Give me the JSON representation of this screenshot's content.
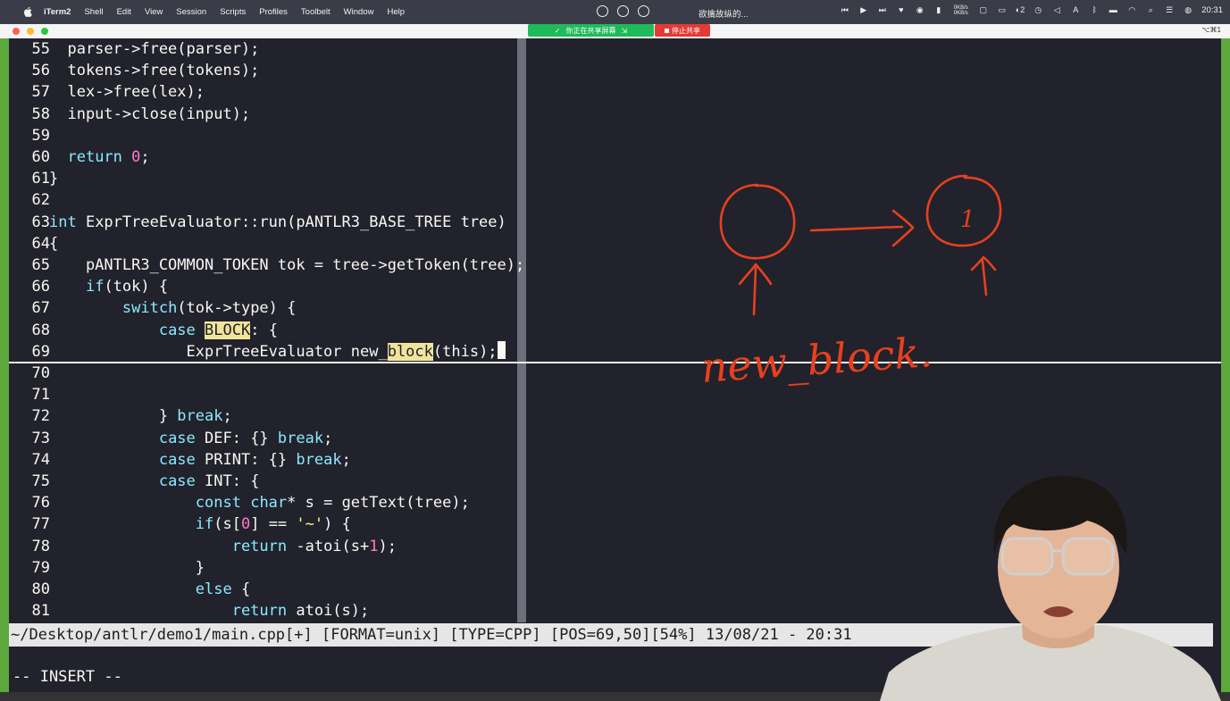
{
  "menubar": {
    "items": [
      "iTerm2",
      "Shell",
      "Edit",
      "View",
      "Session",
      "Scripts",
      "Profiles",
      "Toolbelt",
      "Window",
      "Help"
    ],
    "media_title": "欲擒故纵的...",
    "network_up": "0KB/s",
    "network_down": "0KB/s",
    "badge_count": "2",
    "clock": "20:31",
    "status_icons": [
      "prev-icon",
      "play-icon",
      "next-icon",
      "heart-icon",
      "music-icon",
      "battery-icon",
      "window-icon",
      "display-icon",
      "clock-status-icon",
      "volume-icon",
      "input-source-icon",
      "bluetooth-icon",
      "wifi-icon",
      "search-icon",
      "control-center-icon"
    ]
  },
  "screen_share": {
    "banner_label": "你正在共享屏幕",
    "stop_label": "停止共享"
  },
  "window": {
    "shortcut": "⌥⌘1",
    "colors": {
      "frame": "#5ea83d",
      "background": "#21222c",
      "keyword": "#8be9fd",
      "number": "#ff79c6",
      "search_highlight": "#f1e49a"
    }
  },
  "editor": {
    "lines": [
      {
        "num": "55",
        "parts": [
          {
            "t": "  parser->free(parser);"
          }
        ]
      },
      {
        "num": "56",
        "parts": [
          {
            "t": "  tokens->free(tokens);"
          }
        ]
      },
      {
        "num": "57",
        "parts": [
          {
            "t": "  lex->free(lex);"
          }
        ]
      },
      {
        "num": "58",
        "parts": [
          {
            "t": "  input->close(input);"
          }
        ]
      },
      {
        "num": "59",
        "parts": []
      },
      {
        "num": "60",
        "parts": [
          {
            "t": "  "
          },
          {
            "t": "return",
            "c": "kw"
          },
          {
            "t": " "
          },
          {
            "t": "0",
            "c": "num"
          },
          {
            "t": ";"
          }
        ]
      },
      {
        "num": "61",
        "parts": [
          {
            "t": "}"
          }
        ]
      },
      {
        "num": "62",
        "parts": []
      },
      {
        "num": "63",
        "parts": [
          {
            "t": "int",
            "c": "kw"
          },
          {
            "t": " ExprTreeEvaluator::run(pANTLR3_BASE_TREE tree)"
          }
        ]
      },
      {
        "num": "64",
        "parts": [
          {
            "t": "{"
          }
        ]
      },
      {
        "num": "65",
        "parts": [
          {
            "t": "    pANTLR3_COMMON_TOKEN tok = tree->getToken(tree);"
          }
        ]
      },
      {
        "num": "66",
        "parts": [
          {
            "t": "    "
          },
          {
            "t": "if",
            "c": "kw"
          },
          {
            "t": "(tok) {"
          }
        ]
      },
      {
        "num": "67",
        "parts": [
          {
            "t": "        "
          },
          {
            "t": "switch",
            "c": "kw"
          },
          {
            "t": "(tok->type) {"
          }
        ]
      },
      {
        "num": "68",
        "parts": [
          {
            "t": "            "
          },
          {
            "t": "case",
            "c": "kw"
          },
          {
            "t": " "
          },
          {
            "t": "BLOCK",
            "c": "hl"
          },
          {
            "t": ": {"
          }
        ]
      },
      {
        "num": "69",
        "parts": [
          {
            "t": "               ExprTreeEvaluator new_"
          },
          {
            "t": "block",
            "c": "hl"
          },
          {
            "t": "(this);"
          }
        ]
      },
      {
        "num": "70",
        "parts": []
      },
      {
        "num": "71",
        "parts": []
      },
      {
        "num": "72",
        "parts": [
          {
            "t": "            } "
          },
          {
            "t": "break",
            "c": "kw"
          },
          {
            "t": ";"
          }
        ]
      },
      {
        "num": "73",
        "parts": [
          {
            "t": "            "
          },
          {
            "t": "case",
            "c": "kw"
          },
          {
            "t": " DEF: {} "
          },
          {
            "t": "break",
            "c": "kw"
          },
          {
            "t": ";"
          }
        ]
      },
      {
        "num": "74",
        "parts": [
          {
            "t": "            "
          },
          {
            "t": "case",
            "c": "kw"
          },
          {
            "t": " PRINT: {} "
          },
          {
            "t": "break",
            "c": "kw"
          },
          {
            "t": ";"
          }
        ]
      },
      {
        "num": "75",
        "parts": [
          {
            "t": "            "
          },
          {
            "t": "case",
            "c": "kw"
          },
          {
            "t": " INT: {"
          }
        ]
      },
      {
        "num": "76",
        "parts": [
          {
            "t": "                "
          },
          {
            "t": "const",
            "c": "kw"
          },
          {
            "t": " "
          },
          {
            "t": "char",
            "c": "kw"
          },
          {
            "t": "* s = getText(tree);"
          }
        ]
      },
      {
        "num": "77",
        "parts": [
          {
            "t": "                "
          },
          {
            "t": "if",
            "c": "kw"
          },
          {
            "t": "(s["
          },
          {
            "t": "0",
            "c": "num"
          },
          {
            "t": "] == "
          },
          {
            "t": "'~'",
            "c": "str"
          },
          {
            "t": ") {"
          }
        ]
      },
      {
        "num": "78",
        "parts": [
          {
            "t": "                    "
          },
          {
            "t": "return",
            "c": "kw"
          },
          {
            "t": " -atoi(s+"
          },
          {
            "t": "1",
            "c": "num"
          },
          {
            "t": ");"
          }
        ]
      },
      {
        "num": "79",
        "parts": [
          {
            "t": "                }"
          }
        ]
      },
      {
        "num": "80",
        "parts": [
          {
            "t": "                "
          },
          {
            "t": "else",
            "c": "kw"
          },
          {
            "t": " {"
          }
        ]
      },
      {
        "num": "81",
        "parts": [
          {
            "t": "                    "
          },
          {
            "t": "return",
            "c": "kw"
          },
          {
            "t": " atoi(s);"
          }
        ]
      }
    ]
  },
  "statusline": {
    "text": "~/Desktop/antlr/demo1/main.cpp[+] [FORMAT=unix] [TYPE=CPP] [POS=69,50][54%] 13/08/21 - 20:31"
  },
  "mode": {
    "text": "-- INSERT --"
  },
  "annotation": {
    "node_label": "1",
    "caption": "new_block."
  }
}
